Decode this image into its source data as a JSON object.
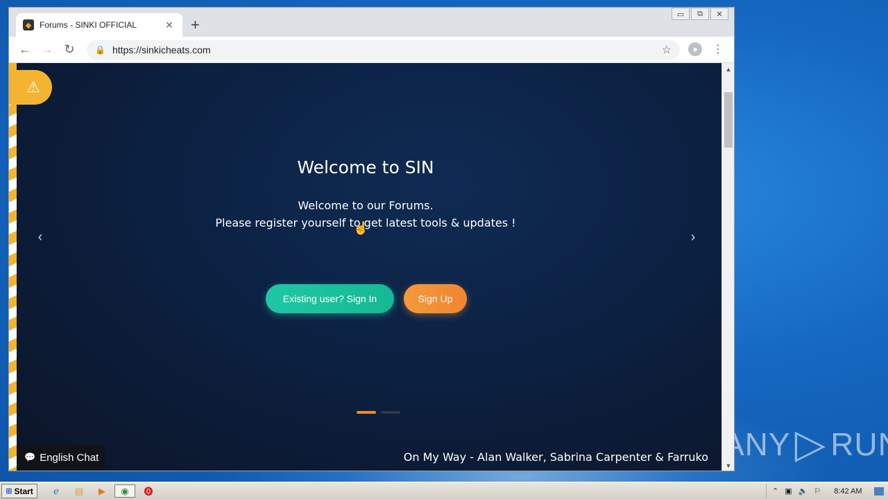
{
  "browser": {
    "tab_title": "Forums - SINKI OFFICIAL",
    "tab_close": "✕",
    "new_tab": "+",
    "url": "https://sinkicheats.com",
    "back": "←",
    "forward": "→",
    "reload": "↻",
    "bookmark_star": "☆",
    "menu": "⋮",
    "window_controls": {
      "minimize": "▭",
      "restore": "⧉",
      "close": "✕"
    }
  },
  "page": {
    "hero_title": "Welcome to SIN",
    "hero_line1": "Welcome to our Forums.",
    "hero_line2": "Please register yourself to get latest tools & updates !",
    "signin_label": "Existing user? Sign In",
    "signup_label": "Sign Up",
    "prev_arrow": "‹",
    "next_arrow": "›",
    "chat_label": "English Chat",
    "song_title": "On My Way - Alan Walker, Sabrina Carpenter & Farruko",
    "colors": {
      "accent_signin": "#1ec8a5",
      "accent_signup": "#f08a2e",
      "alert": "#f4b330"
    }
  },
  "taskbar": {
    "start_label": "Start",
    "clock": "8:42 AM"
  },
  "desktop": {
    "watermark_left": "ANY",
    "watermark_right": "RUN"
  }
}
